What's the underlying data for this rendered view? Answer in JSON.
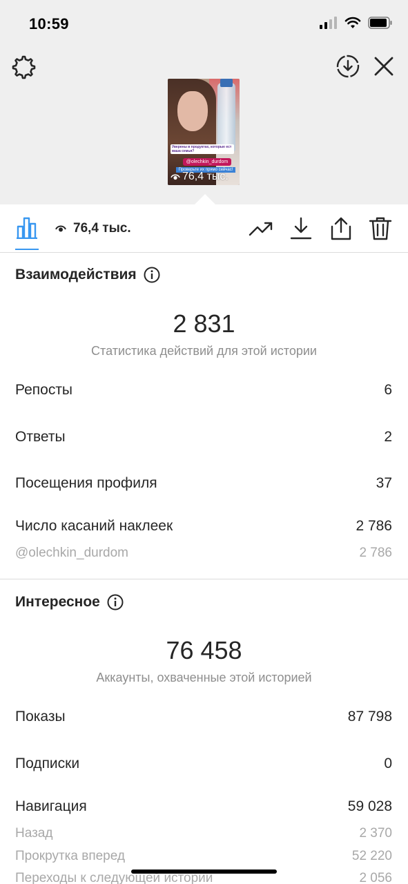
{
  "status_bar": {
    "time": "10:59"
  },
  "story": {
    "views_overlay": "76,4 тыс.",
    "sticker_text": "Уверены в продуктах, которые ест ваша семья?",
    "mention_sticker": "@olechkin_durdom",
    "cta_text": "Проверьте их прямо сейчас!"
  },
  "toolbar": {
    "views": "76,4 тыс."
  },
  "interactions": {
    "title": "Взаимодействия",
    "total": "2 831",
    "subtitle": "Статистика действий для этой истории",
    "rows": [
      {
        "label": "Репосты",
        "value": "6"
      },
      {
        "label": "Ответы",
        "value": "2"
      },
      {
        "label": "Посещения профиля",
        "value": "37"
      },
      {
        "label": "Число касаний наклеек",
        "value": "2 786"
      }
    ],
    "sub_rows": [
      {
        "label": "@olechkin_durdom",
        "value": "2 786"
      }
    ]
  },
  "discovery": {
    "title": "Интересное",
    "total": "76 458",
    "subtitle": "Аккаунты, охваченные этой историей",
    "rows": [
      {
        "label": "Показы",
        "value": "87 798"
      },
      {
        "label": "Подписки",
        "value": "0"
      },
      {
        "label": "Навигация",
        "value": "59 028"
      }
    ],
    "sub_rows": [
      {
        "label": "Назад",
        "value": "2 370"
      },
      {
        "label": "Прокрутка вперед",
        "value": "52 220"
      },
      {
        "label": "Переходы к следующей истории",
        "value": "2 056"
      }
    ]
  },
  "colors": {
    "accent": "#3897f0",
    "text": "#262626",
    "muted": "#8e8e8e",
    "header_bg": "#efefef"
  }
}
